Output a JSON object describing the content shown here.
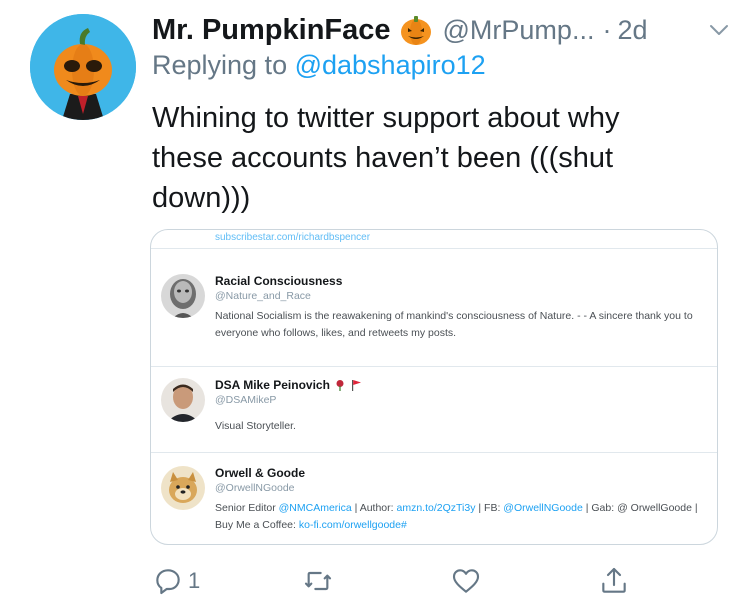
{
  "tweet": {
    "author": {
      "display_name": "Mr. PumpkinFace",
      "emoji": "jack-o-lantern",
      "handle": "@MrPump...",
      "separator": "·",
      "age": "2d"
    },
    "replying_prefix": "Replying to ",
    "replying_to": "@dabshapiro12",
    "text": "Whining to twitter support about why\nthese accounts haven’t been (((shut\ndown)))",
    "actions": {
      "reply_count": "1"
    }
  },
  "card": {
    "top_link": "subscribestar.com/richardbspencer",
    "accounts": [
      {
        "name": "Racial Consciousness",
        "handle": "@Nature_and_Race",
        "bio": "National Socialism is the reawakening of mankind's consciousness of Nature. - - A sincere thank you to everyone who follows, likes, and retweets my posts."
      },
      {
        "name": "DSA Mike Peinovich",
        "handle": "@DSAMikeP",
        "bio": "Visual Storyteller."
      },
      {
        "name": "Orwell & Goode",
        "handle": "@OrwellNGoode",
        "bio_prefix": "Senior Editor ",
        "bio_mention1": "@NMCAmerica",
        "bio_mid1": " | Author: ",
        "bio_link1": "amzn.to/2QzTi3y",
        "bio_mid2": " | FB: ",
        "bio_mention2": "@OrwellNGoode",
        "bio_mid3": " | Gab: @ OrwellGoode | Buy Me a Coffee: ",
        "bio_link2": "ko-fi.com/orwellgoode#"
      }
    ]
  },
  "colors": {
    "link": "#1da1f2",
    "muted": "#657786",
    "text": "#14171a",
    "avatar_bg": "#3fb6e8",
    "pumpkin": "#f08a1c"
  }
}
